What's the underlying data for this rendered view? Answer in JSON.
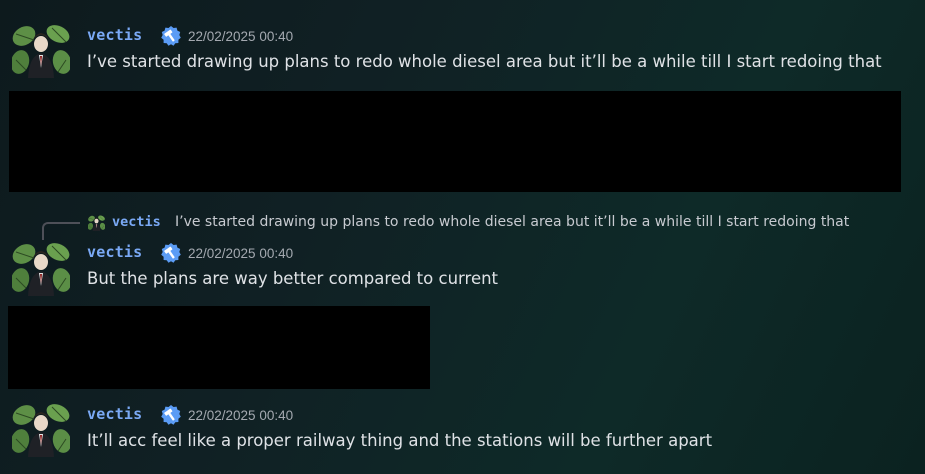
{
  "messages": [
    {
      "username": "vectis",
      "badge_icon": "hammer-badge-icon",
      "timestamp": "22/02/2025 00:40",
      "text": "I’ve started drawing up plans to redo whole diesel area but it’ll be a while till I start redoing that"
    },
    {
      "reply": {
        "username": "vectis",
        "text": "I’ve started drawing up plans to redo whole diesel area but it’ll be a while till I start redoing that"
      },
      "username": "vectis",
      "badge_icon": "hammer-badge-icon",
      "timestamp": "22/02/2025 00:40",
      "text": "But the plans are way better compared to current"
    },
    {
      "username": "vectis",
      "badge_icon": "hammer-badge-icon",
      "timestamp": "22/02/2025 00:40",
      "text": "It’ll acc feel like a proper railway thing and the stations will be further apart"
    }
  ],
  "colors": {
    "username": "#7aa9f5",
    "badge": "#5b9cf5",
    "embed_redacted": "#000000"
  }
}
